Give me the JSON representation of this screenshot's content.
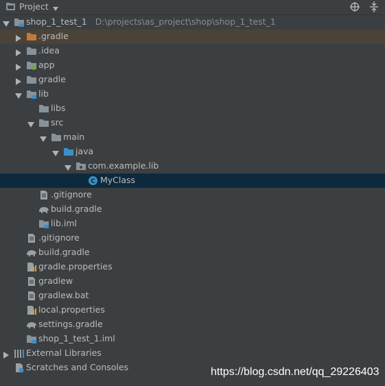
{
  "header": {
    "title": "Project"
  },
  "tree": {
    "root": {
      "label": "shop_1_test_1",
      "path": "D:\\projects\\as_project\\shop\\shop_1_test_1"
    },
    "gradle_dir": ".gradle",
    "idea_dir": ".idea",
    "app_dir": "app",
    "gradle_wrapper_dir": "gradle",
    "lib_dir": "lib",
    "lib_libs": "libs",
    "lib_src": "src",
    "lib_main": "main",
    "lib_java": "java",
    "lib_package": "com.example.lib",
    "lib_class": "MyClass",
    "lib_gitignore": ".gitignore",
    "lib_build_gradle": "build.gradle",
    "lib_iml": "lib.iml",
    "root_gitignore": ".gitignore",
    "root_build_gradle": "build.gradle",
    "gradle_properties": "gradle.properties",
    "gradlew": "gradlew",
    "gradlew_bat": "gradlew.bat",
    "local_properties": "local.properties",
    "settings_gradle": "settings.gradle",
    "root_iml": "shop_1_test_1.iml",
    "external_libraries": "External Libraries",
    "scratches": "Scratches and Consoles"
  },
  "watermark": "https://blog.csdn.net/qq_29226403",
  "colors": {
    "background": "#3c3f41",
    "selection": "#0d293e",
    "excluded_row": "#4b4338",
    "folder": "#87939a",
    "source_folder": "#3d8ec9",
    "excluded_folder": "#c07a3e",
    "class_icon": "#3592c4"
  }
}
